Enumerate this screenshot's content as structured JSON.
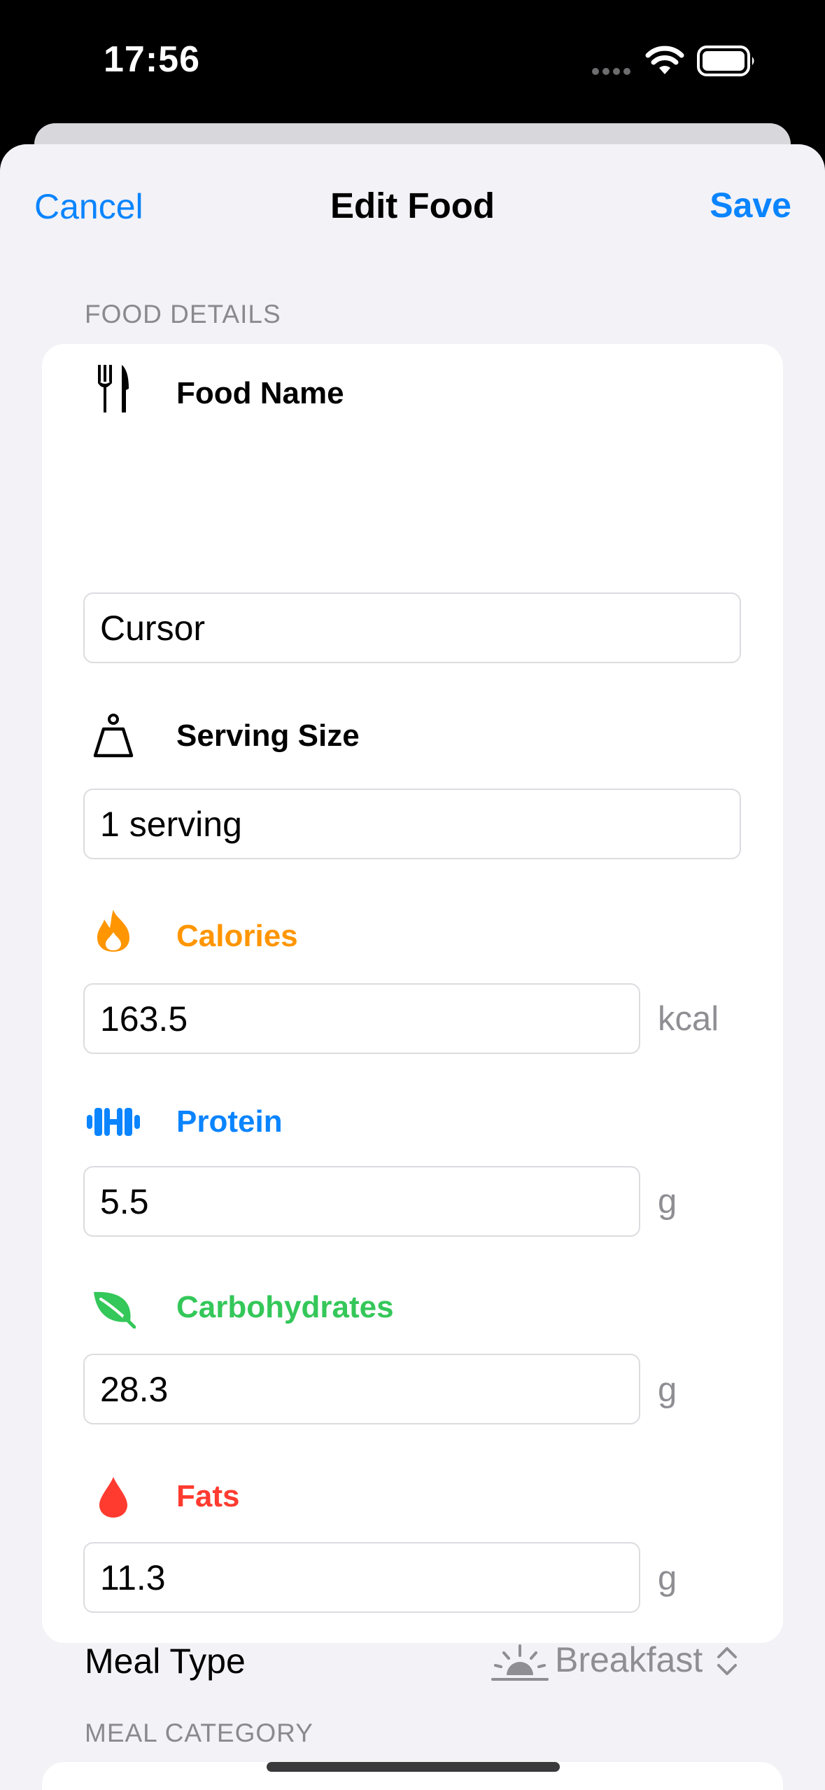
{
  "status_bar": {
    "time": "17:56"
  },
  "nav": {
    "cancel": "Cancel",
    "title": "Edit Food",
    "save": "Save"
  },
  "food_details": {
    "header": "FOOD DETAILS",
    "food_name": {
      "label": "Food Name",
      "value": "Cursor",
      "icon": "fork-knife-icon"
    },
    "serving_size": {
      "label": "Serving Size",
      "value": "1 serving",
      "icon": "scale-icon"
    },
    "calories": {
      "label": "Calories",
      "value": "163.5",
      "unit": "kcal",
      "color": "#ff9500",
      "icon": "flame-icon"
    },
    "protein": {
      "label": "Protein",
      "value": "5.5",
      "unit": "g",
      "color": "#0a84ff",
      "icon": "dumbbell-icon"
    },
    "carbohydrates": {
      "label": "Carbohydrates",
      "value": "28.3",
      "unit": "g",
      "color": "#34c759",
      "icon": "leaf-icon"
    },
    "fats": {
      "label": "Fats",
      "value": "11.3",
      "unit": "g",
      "color": "#ff3b30",
      "icon": "drop-icon"
    }
  },
  "meal_category": {
    "header": "MEAL CATEGORY",
    "label": "Meal Type",
    "value": "Breakfast",
    "icon": "sunrise-icon"
  }
}
